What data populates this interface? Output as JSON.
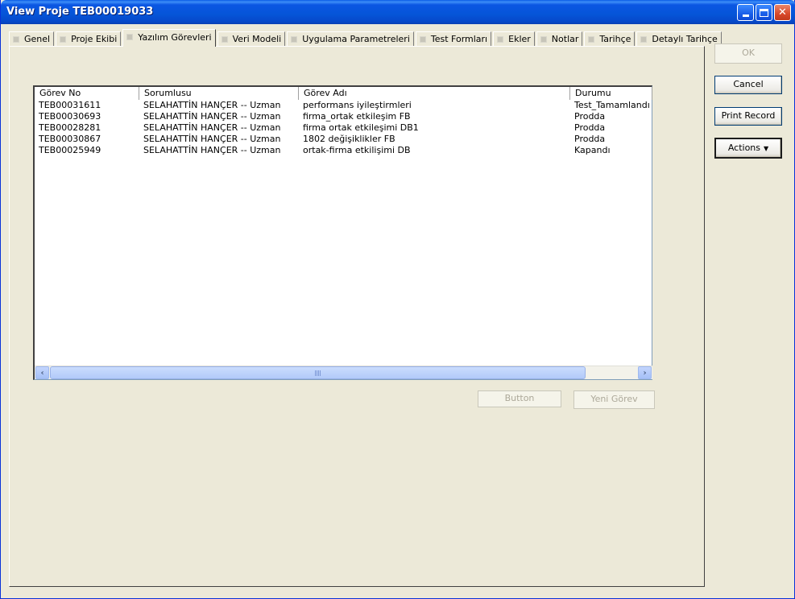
{
  "window": {
    "title": "View Proje TEB00019033"
  },
  "tabs": [
    {
      "label": "Genel"
    },
    {
      "label": "Proje Ekibi"
    },
    {
      "label": "Yazılım Görevleri"
    },
    {
      "label": "Veri Modeli"
    },
    {
      "label": "Uygulama Parametreleri"
    },
    {
      "label": "Test Formları"
    },
    {
      "label": "Ekler"
    },
    {
      "label": "Notlar"
    },
    {
      "label": "Tarihçe"
    },
    {
      "label": "Detaylı Tarihçe"
    }
  ],
  "list": {
    "columns": [
      "Görev No",
      "Sorumlusu",
      "Görev Adı",
      "Durumu"
    ],
    "rows": [
      [
        "TEB00031611",
        "SELAHATTİN HANÇER -- Uzman",
        "performans iyileştirmleri",
        "Test_Tamamlandı"
      ],
      [
        "TEB00030693",
        "SELAHATTİN HANÇER -- Uzman",
        "firma_ortak etkileşim FB",
        "Prodda"
      ],
      [
        "TEB00028281",
        "SELAHATTİN HANÇER -- Uzman",
        "firma ortak etkileşimi DB1",
        "Prodda"
      ],
      [
        "TEB00030867",
        "SELAHATTİN HANÇER -- Uzman",
        "1802 değişiklikler FB",
        "Prodda"
      ],
      [
        "TEB00025949",
        "SELAHATTİN HANÇER -- Uzman",
        "ortak-firma etkilişimi DB",
        "Kapandı"
      ]
    ]
  },
  "panel_buttons": {
    "button": "Button",
    "new_task": "Yeni Görev"
  },
  "side_buttons": {
    "ok": "OK",
    "cancel": "Cancel",
    "print": "Print Record",
    "actions": "Actions"
  }
}
